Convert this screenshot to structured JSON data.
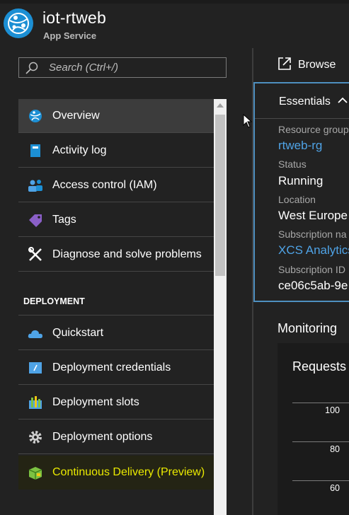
{
  "app": {
    "title": "iot-rtweb",
    "subtitle": "App Service",
    "icon": "app-service-globe-icon"
  },
  "search": {
    "placeholder": "Search (Ctrl+/)"
  },
  "menu": {
    "items": [
      {
        "label": "Overview",
        "icon": "overview-globe-icon",
        "selected": true
      },
      {
        "label": "Activity log",
        "icon": "activity-log-icon"
      },
      {
        "label": "Access control (IAM)",
        "icon": "access-control-icon"
      },
      {
        "label": "Tags",
        "icon": "tag-icon"
      },
      {
        "label": "Diagnose and solve problems",
        "icon": "diagnose-tools-icon"
      }
    ],
    "section": "DEPLOYMENT",
    "deployment_items": [
      {
        "label": "Quickstart",
        "icon": "quickstart-cloud-icon"
      },
      {
        "label": "Deployment credentials",
        "icon": "deployment-credentials-icon"
      },
      {
        "label": "Deployment slots",
        "icon": "deployment-slots-icon"
      },
      {
        "label": "Deployment options",
        "icon": "gear-icon"
      },
      {
        "label": "Continuous Delivery (Preview)",
        "icon": "continuous-delivery-icon",
        "highlighted": true
      }
    ]
  },
  "toolbar": {
    "browse": "Browse"
  },
  "essentials": {
    "title": "Essentials",
    "fields": [
      {
        "label": "Resource group",
        "value": "rtweb-rg",
        "link": true
      },
      {
        "label": "Status",
        "value": "Running"
      },
      {
        "label": "Location",
        "value": "West Europe"
      },
      {
        "label": "Subscription na",
        "value": "XCS Analytics",
        "link": true
      },
      {
        "label": "Subscription ID",
        "value": "ce06c5ab-9e"
      }
    ]
  },
  "monitoring": {
    "title": "Monitoring",
    "chart_title": "Requests",
    "ticks": [
      "100",
      "80",
      "60"
    ]
  },
  "colors": {
    "background": "#222222",
    "link": "#4fa3e6",
    "accent_border": "#4e8fbf",
    "highlight_text": "#eaea00"
  }
}
